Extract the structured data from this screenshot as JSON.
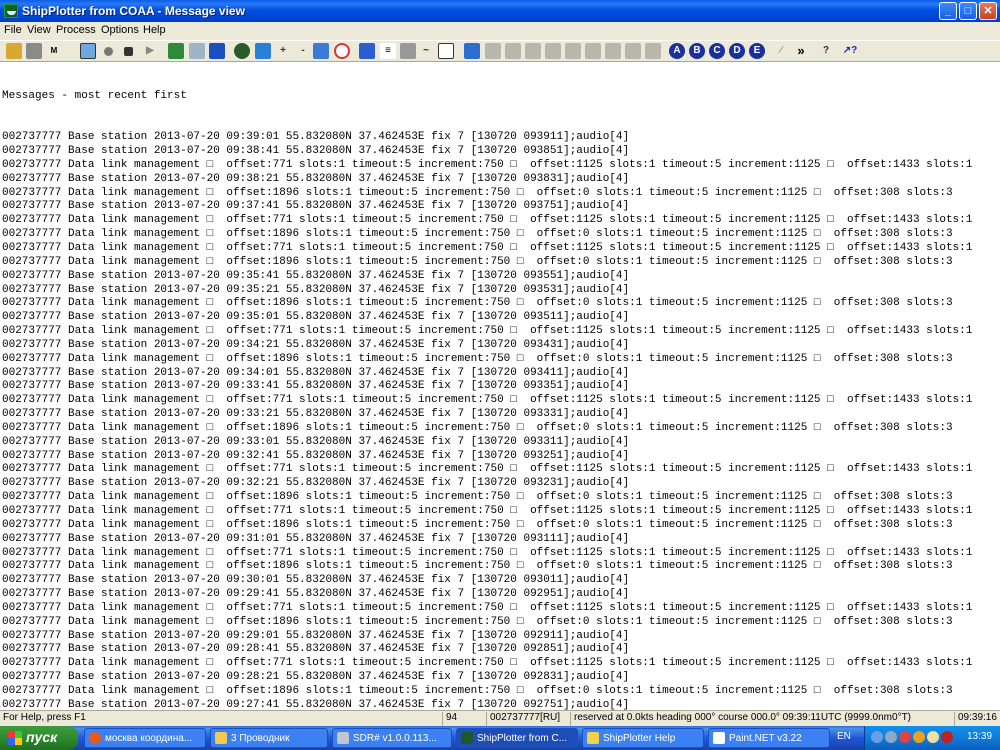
{
  "window": {
    "title": "ShipPlotter from COAA - Message view"
  },
  "menu": [
    "File",
    "View",
    "Process",
    "Options",
    "Help"
  ],
  "toolbar_letters": [
    "A",
    "B",
    "C",
    "D",
    "E"
  ],
  "messages_header": "Messages - most recent first",
  "messages": [
    "002737777 Base station 2013-07-20 09:39:01 55.832080N 37.462453E fix 7 [130720 093911];audio[4]",
    "002737777 Base station 2013-07-20 09:38:41 55.832080N 37.462453E fix 7 [130720 093851];audio[4]",
    "002737777 Data link management □  offset:771 slots:1 timeout:5 increment:750 □  offset:1125 slots:1 timeout:5 increment:1125 □  offset:1433 slots:1",
    "002737777 Base station 2013-07-20 09:38:21 55.832080N 37.462453E fix 7 [130720 093831];audio[4]",
    "002737777 Data link management □  offset:1896 slots:1 timeout:5 increment:750 □  offset:0 slots:1 timeout:5 increment:1125 □  offset:308 slots:3",
    "002737777 Base station 2013-07-20 09:37:41 55.832080N 37.462453E fix 7 [130720 093751];audio[4]",
    "002737777 Data link management □  offset:771 slots:1 timeout:5 increment:750 □  offset:1125 slots:1 timeout:5 increment:1125 □  offset:1433 slots:1",
    "002737777 Data link management □  offset:1896 slots:1 timeout:5 increment:750 □  offset:0 slots:1 timeout:5 increment:1125 □  offset:308 slots:3",
    "002737777 Data link management □  offset:771 slots:1 timeout:5 increment:750 □  offset:1125 slots:1 timeout:5 increment:1125 □  offset:1433 slots:1",
    "002737777 Data link management □  offset:1896 slots:1 timeout:5 increment:750 □  offset:0 slots:1 timeout:5 increment:1125 □  offset:308 slots:3",
    "002737777 Base station 2013-07-20 09:35:41 55.832080N 37.462453E fix 7 [130720 093551];audio[4]",
    "002737777 Base station 2013-07-20 09:35:21 55.832080N 37.462453E fix 7 [130720 093531];audio[4]",
    "002737777 Data link management □  offset:1896 slots:1 timeout:5 increment:750 □  offset:0 slots:1 timeout:5 increment:1125 □  offset:308 slots:3",
    "002737777 Base station 2013-07-20 09:35:01 55.832080N 37.462453E fix 7 [130720 093511];audio[4]",
    "002737777 Data link management □  offset:771 slots:1 timeout:5 increment:750 □  offset:1125 slots:1 timeout:5 increment:1125 □  offset:1433 slots:1",
    "002737777 Base station 2013-07-20 09:34:21 55.832080N 37.462453E fix 7 [130720 093431];audio[4]",
    "002737777 Data link management □  offset:1896 slots:1 timeout:5 increment:750 □  offset:0 slots:1 timeout:5 increment:1125 □  offset:308 slots:3",
    "002737777 Base station 2013-07-20 09:34:01 55.832080N 37.462453E fix 7 [130720 093411];audio[4]",
    "002737777 Base station 2013-07-20 09:33:41 55.832080N 37.462453E fix 7 [130720 093351];audio[4]",
    "002737777 Data link management □  offset:771 slots:1 timeout:5 increment:750 □  offset:1125 slots:1 timeout:5 increment:1125 □  offset:1433 slots:1",
    "002737777 Base station 2013-07-20 09:33:21 55.832080N 37.462453E fix 7 [130720 093331];audio[4]",
    "002737777 Data link management □  offset:1896 slots:1 timeout:5 increment:750 □  offset:0 slots:1 timeout:5 increment:1125 □  offset:308 slots:3",
    "002737777 Base station 2013-07-20 09:33:01 55.832080N 37.462453E fix 7 [130720 093311];audio[4]",
    "002737777 Base station 2013-07-20 09:32:41 55.832080N 37.462453E fix 7 [130720 093251];audio[4]",
    "002737777 Data link management □  offset:771 slots:1 timeout:5 increment:750 □  offset:1125 slots:1 timeout:5 increment:1125 □  offset:1433 slots:1",
    "002737777 Base station 2013-07-20 09:32:21 55.832080N 37.462453E fix 7 [130720 093231];audio[4]",
    "002737777 Data link management □  offset:1896 slots:1 timeout:5 increment:750 □  offset:0 slots:1 timeout:5 increment:1125 □  offset:308 slots:3",
    "002737777 Data link management □  offset:771 slots:1 timeout:5 increment:750 □  offset:1125 slots:1 timeout:5 increment:1125 □  offset:1433 slots:1",
    "002737777 Data link management □  offset:1896 slots:1 timeout:5 increment:750 □  offset:0 slots:1 timeout:5 increment:1125 □  offset:308 slots:3",
    "002737777 Base station 2013-07-20 09:31:01 55.832080N 37.462453E fix 7 [130720 093111];audio[4]",
    "002737777 Data link management □  offset:771 slots:1 timeout:5 increment:750 □  offset:1125 slots:1 timeout:5 increment:1125 □  offset:1433 slots:1",
    "002737777 Data link management □  offset:1896 slots:1 timeout:5 increment:750 □  offset:0 slots:1 timeout:5 increment:1125 □  offset:308 slots:3",
    "002737777 Base station 2013-07-20 09:30:01 55.832080N 37.462453E fix 7 [130720 093011];audio[4]",
    "002737777 Base station 2013-07-20 09:29:41 55.832080N 37.462453E fix 7 [130720 092951];audio[4]",
    "002737777 Data link management □  offset:771 slots:1 timeout:5 increment:750 □  offset:1125 slots:1 timeout:5 increment:1125 □  offset:1433 slots:1",
    "002737777 Data link management □  offset:1896 slots:1 timeout:5 increment:750 □  offset:0 slots:1 timeout:5 increment:1125 □  offset:308 slots:3",
    "002737777 Base station 2013-07-20 09:29:01 55.832080N 37.462453E fix 7 [130720 092911];audio[4]",
    "002737777 Base station 2013-07-20 09:28:41 55.832080N 37.462453E fix 7 [130720 092851];audio[4]",
    "002737777 Data link management □  offset:771 slots:1 timeout:5 increment:750 □  offset:1125 slots:1 timeout:5 increment:1125 □  offset:1433 slots:1",
    "002737777 Base station 2013-07-20 09:28:21 55.832080N 37.462453E fix 7 [130720 092831];audio[4]",
    "002737777 Data link management □  offset:1896 slots:1 timeout:5 increment:750 □  offset:0 slots:1 timeout:5 increment:1125 □  offset:308 slots:3",
    "002737777 Base station 2013-07-20 09:27:41 55.832080N 37.462453E fix 7 [130720 092751];audio[4]",
    "002737777 Data link management □  offset:771 slots:1 timeout:5 increment:750 □  offset:1125 slots:1 timeout:5 increment:1125 □  offset:1433 slots:1",
    "002737777 Base station 2013-07-20 09:27:21 55.832080N 37.462453E fix 7 [130720 092731];audio[4]",
    "002737777 Data link management □  offset:1896 slots:1 timeout:5 increment:750 □  offset:0 slots:1 timeout:5 increment:1125 □  offset:308 slots:3"
  ],
  "status": {
    "help": "For Help, press F1",
    "count": "94",
    "mmsi": "002737777[RU]",
    "info": "reserved  at  0.0kts heading 000° course 000.0° 09:39:11UTC (9999.0nm0°T)",
    "time": "09:39:16"
  },
  "taskbar": {
    "start_label": "пуск",
    "tasks": [
      "москва координа...",
      "3 Проводник",
      "SDR# v1.0.0.113...",
      "ShipPlotter from C...",
      "ShipPlotter Help",
      "Paint.NET v3.22"
    ],
    "lang": "EN",
    "clock": "13:39"
  }
}
